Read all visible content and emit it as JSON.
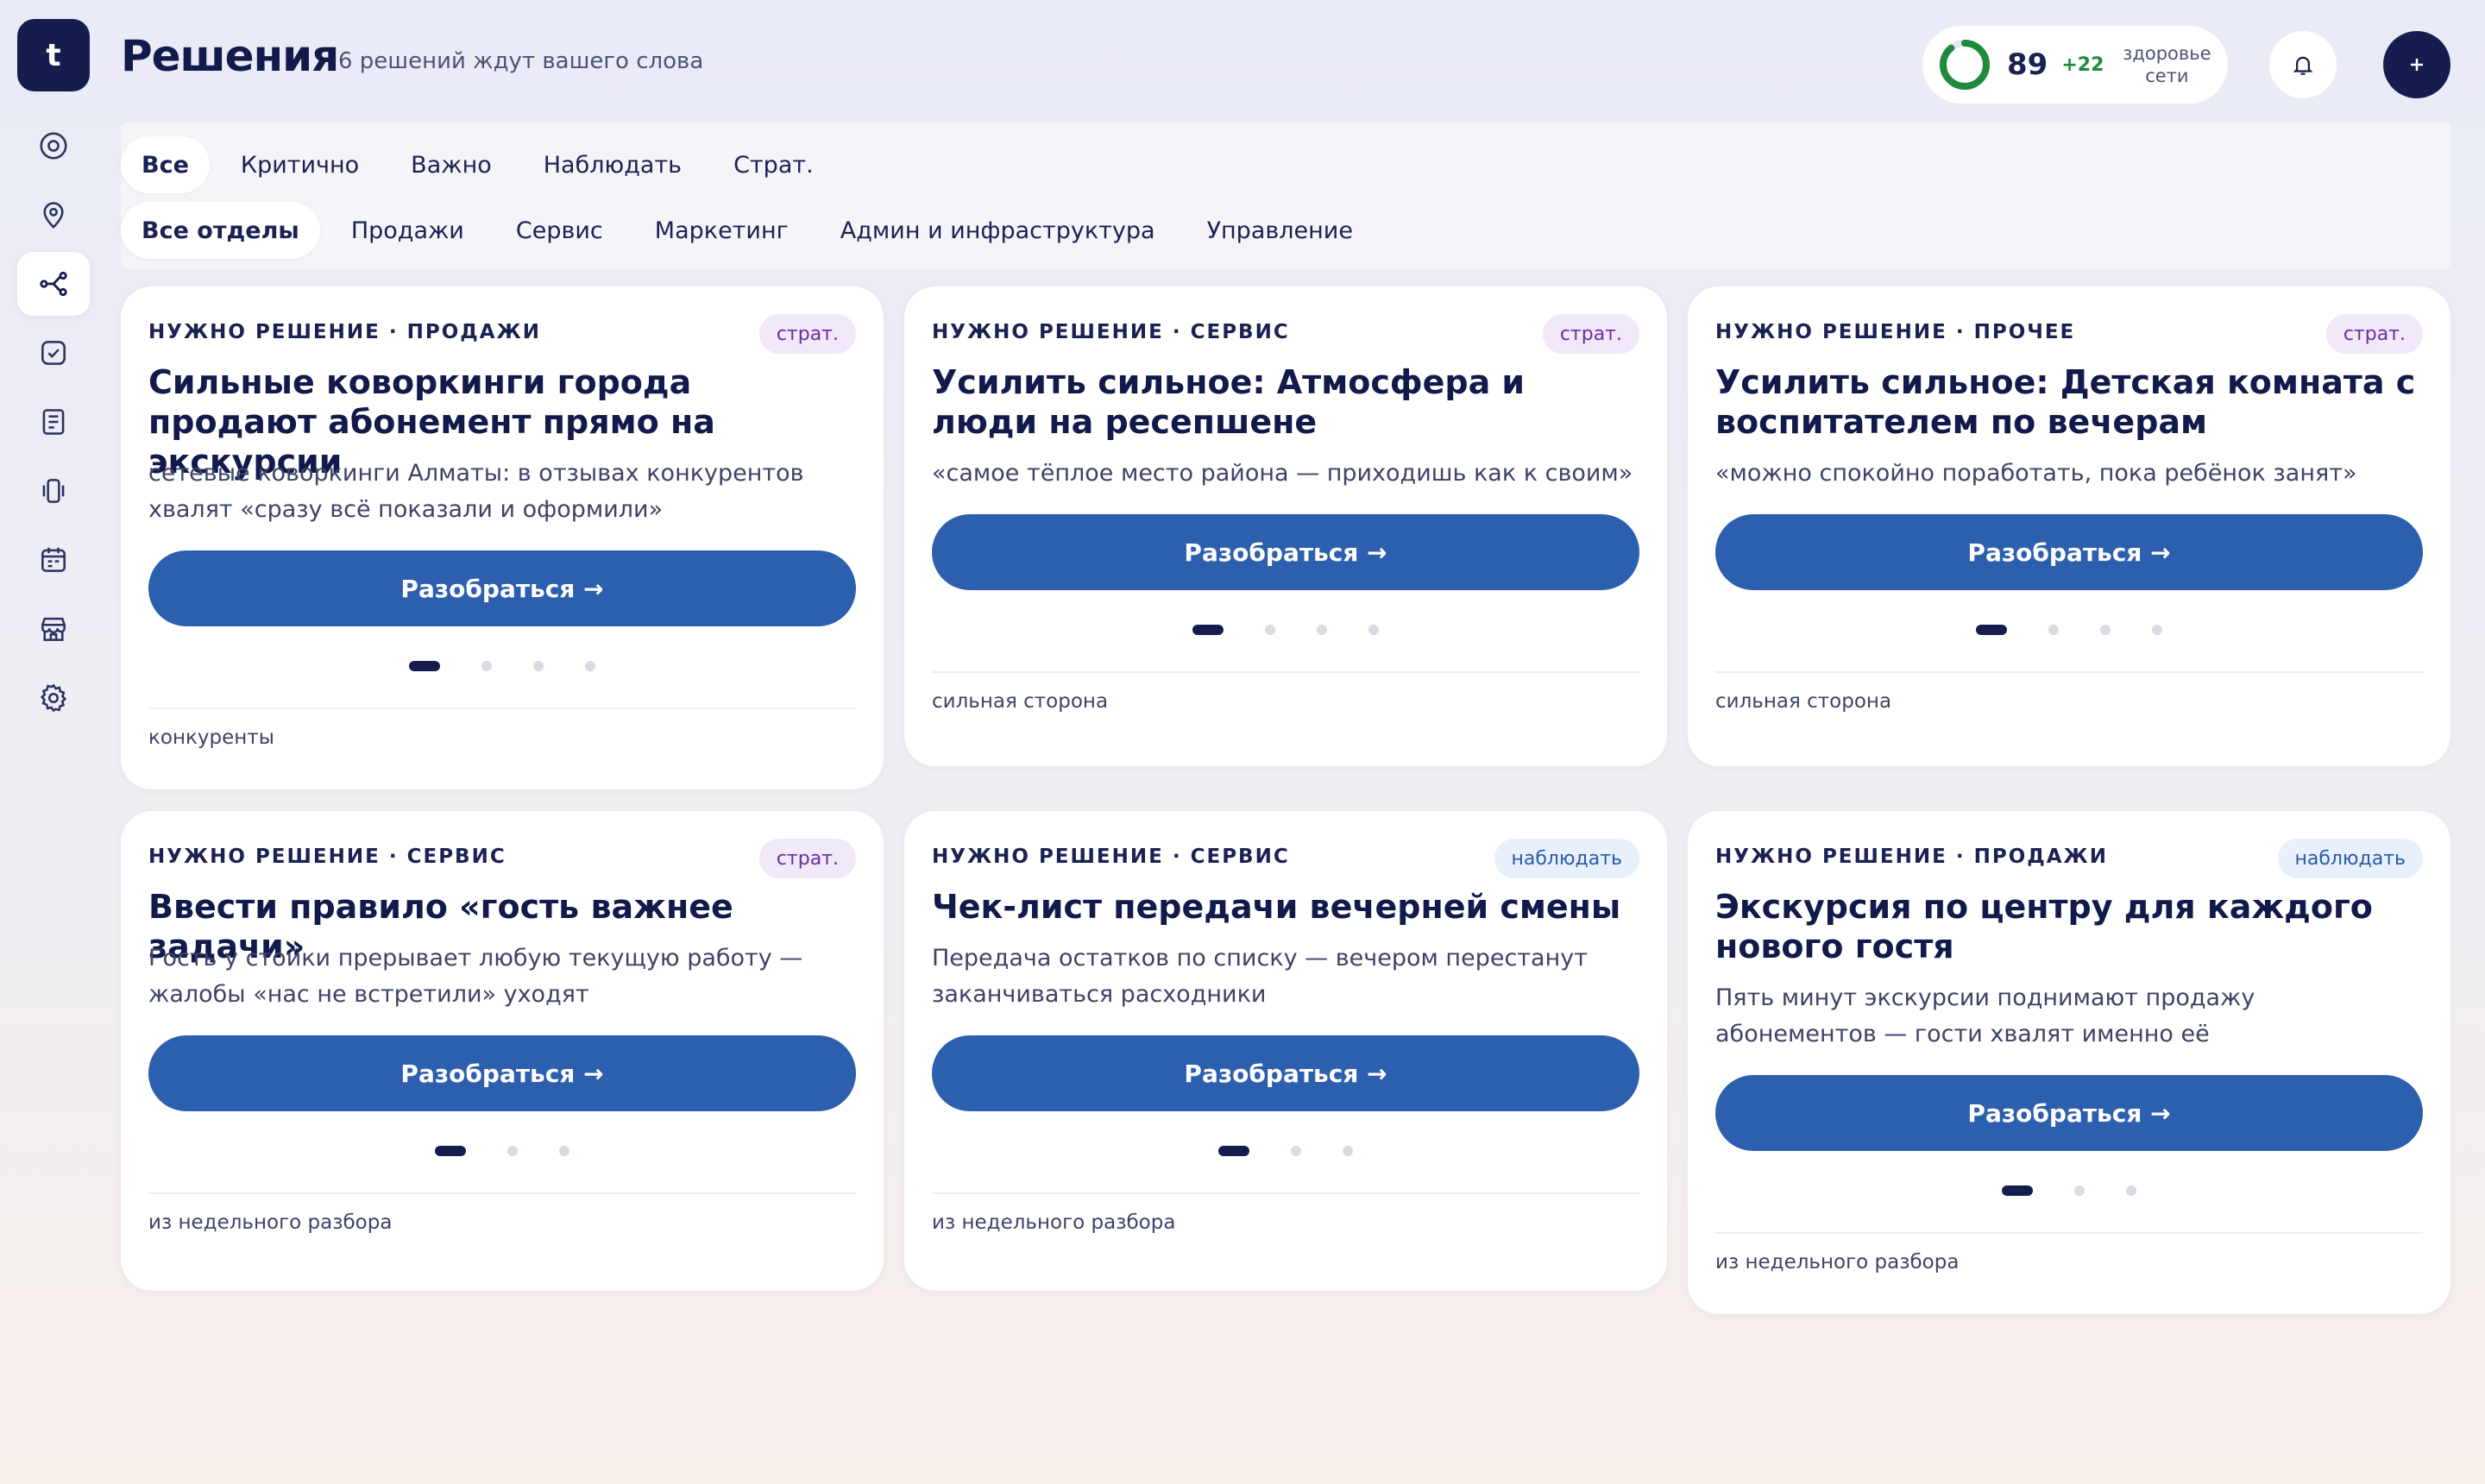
{
  "app": {
    "logo_letter": "t"
  },
  "sidebar": {
    "items": [
      {
        "icon": "target-icon",
        "active": false
      },
      {
        "icon": "map-pin-icon",
        "active": false
      },
      {
        "icon": "decisions-icon",
        "active": true
      },
      {
        "icon": "checkbox-icon",
        "active": false
      },
      {
        "icon": "journal-icon",
        "active": false
      },
      {
        "icon": "vibration-icon",
        "active": false
      },
      {
        "icon": "calendar-icon",
        "active": false
      },
      {
        "icon": "store-icon",
        "active": false
      },
      {
        "icon": "gear-icon",
        "active": false
      }
    ]
  },
  "header": {
    "title": "Решения",
    "subtitle": "6 решений ждут вашего слова",
    "health": {
      "score": "89",
      "delta": "+22",
      "label_line1": "здоровье",
      "label_line2": "сети",
      "ratio": 0.89,
      "color": "#1e8a3a"
    }
  },
  "filters": {
    "priority": [
      "Все",
      "Критично",
      "Важно",
      "Наблюдать",
      "Страт."
    ],
    "priority_active": 0,
    "departments": [
      "Все отделы",
      "Продажи",
      "Сервис",
      "Маркетинг",
      "Админ и инфраструктура",
      "Управление"
    ],
    "departments_active": 0
  },
  "cards": [
    {
      "kicker": "НУЖНО РЕШЕНИЕ · ПРОДАЖИ",
      "badge": "страт.",
      "title": "Сильные коворкинги города продают абонемент прямо на экскурсии",
      "desc": "сетевые коворкинги Алматы: в отзывах конкурентов хвалят «сразу всё показали и оформили»",
      "cta": "Разобраться →",
      "footer": "конкуренты"
    },
    {
      "kicker": "НУЖНО РЕШЕНИЕ · СЕРВИС",
      "badge": "страт.",
      "title": "Усилить сильное: Атмосфера и люди на ресепшене",
      "desc": "«самое тёплое место района — приходишь как к своим»",
      "cta": "Разобраться →",
      "footer": "сильная сторона"
    },
    {
      "kicker": "НУЖНО РЕШЕНИЕ · ПРОЧЕЕ",
      "badge": "страт.",
      "title": "Усилить сильное: Детская комната с воспитателем по вечерам",
      "desc": "«можно спокойно поработать, пока ребёнок занят»",
      "cta": "Разобраться →",
      "footer": "сильная сторона"
    },
    {
      "kicker": "НУЖНО РЕШЕНИЕ · СЕРВИС",
      "badge": "страт.",
      "title": "Ввести правило «гость важнее задачи»",
      "desc": "Гость у стойки прерывает любую текущую работу — жалобы «нас не встретили» уходят",
      "cta": "Разобраться →",
      "footer": "из недельного разбора"
    },
    {
      "kicker": "НУЖНО РЕШЕНИЕ · СЕРВИС",
      "badge": "наблюдать",
      "title": "Чек-лист передачи вечерней смены",
      "desc": "Передача остатков по списку — вечером перестанут заканчиваться расходники",
      "cta": "Разобраться →",
      "footer": "из недельного разбора"
    },
    {
      "kicker": "НУЖНО РЕШЕНИЕ · ПРОДАЖИ",
      "badge": "наблюдать",
      "title": "Экскурсия по центру для каждого нового гостя",
      "desc": "Пять минут экскурсии поднимают продажу абонементов — гости хвалят именно её",
      "cta": "Разобраться →",
      "footer": "из недельного разбора"
    }
  ]
}
